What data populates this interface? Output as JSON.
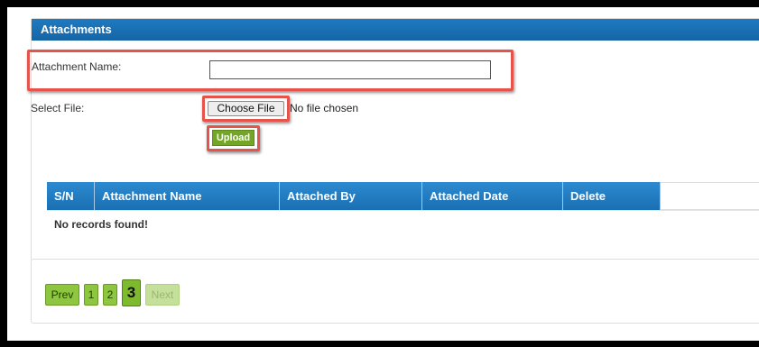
{
  "panel": {
    "title": "Attachments"
  },
  "form": {
    "attachment_name_label": "Attachment Name:",
    "attachment_name_value": "",
    "select_file_label": "Select File:",
    "choose_file_label": "Choose File",
    "no_file_text": "No file chosen",
    "upload_label": "Upload"
  },
  "table": {
    "columns": [
      "S/N",
      "Attachment Name",
      "Attached By",
      "Attached Date",
      "Delete"
    ],
    "empty_message": "No records found!"
  },
  "pager": {
    "prev_label": "Prev",
    "pages": [
      "1",
      "2",
      "3"
    ],
    "current_page": "3",
    "next_label": "Next"
  },
  "colors": {
    "header_blue": "#1565a6",
    "highlight_red": "#e5534b",
    "pager_green": "#8ec63f"
  }
}
